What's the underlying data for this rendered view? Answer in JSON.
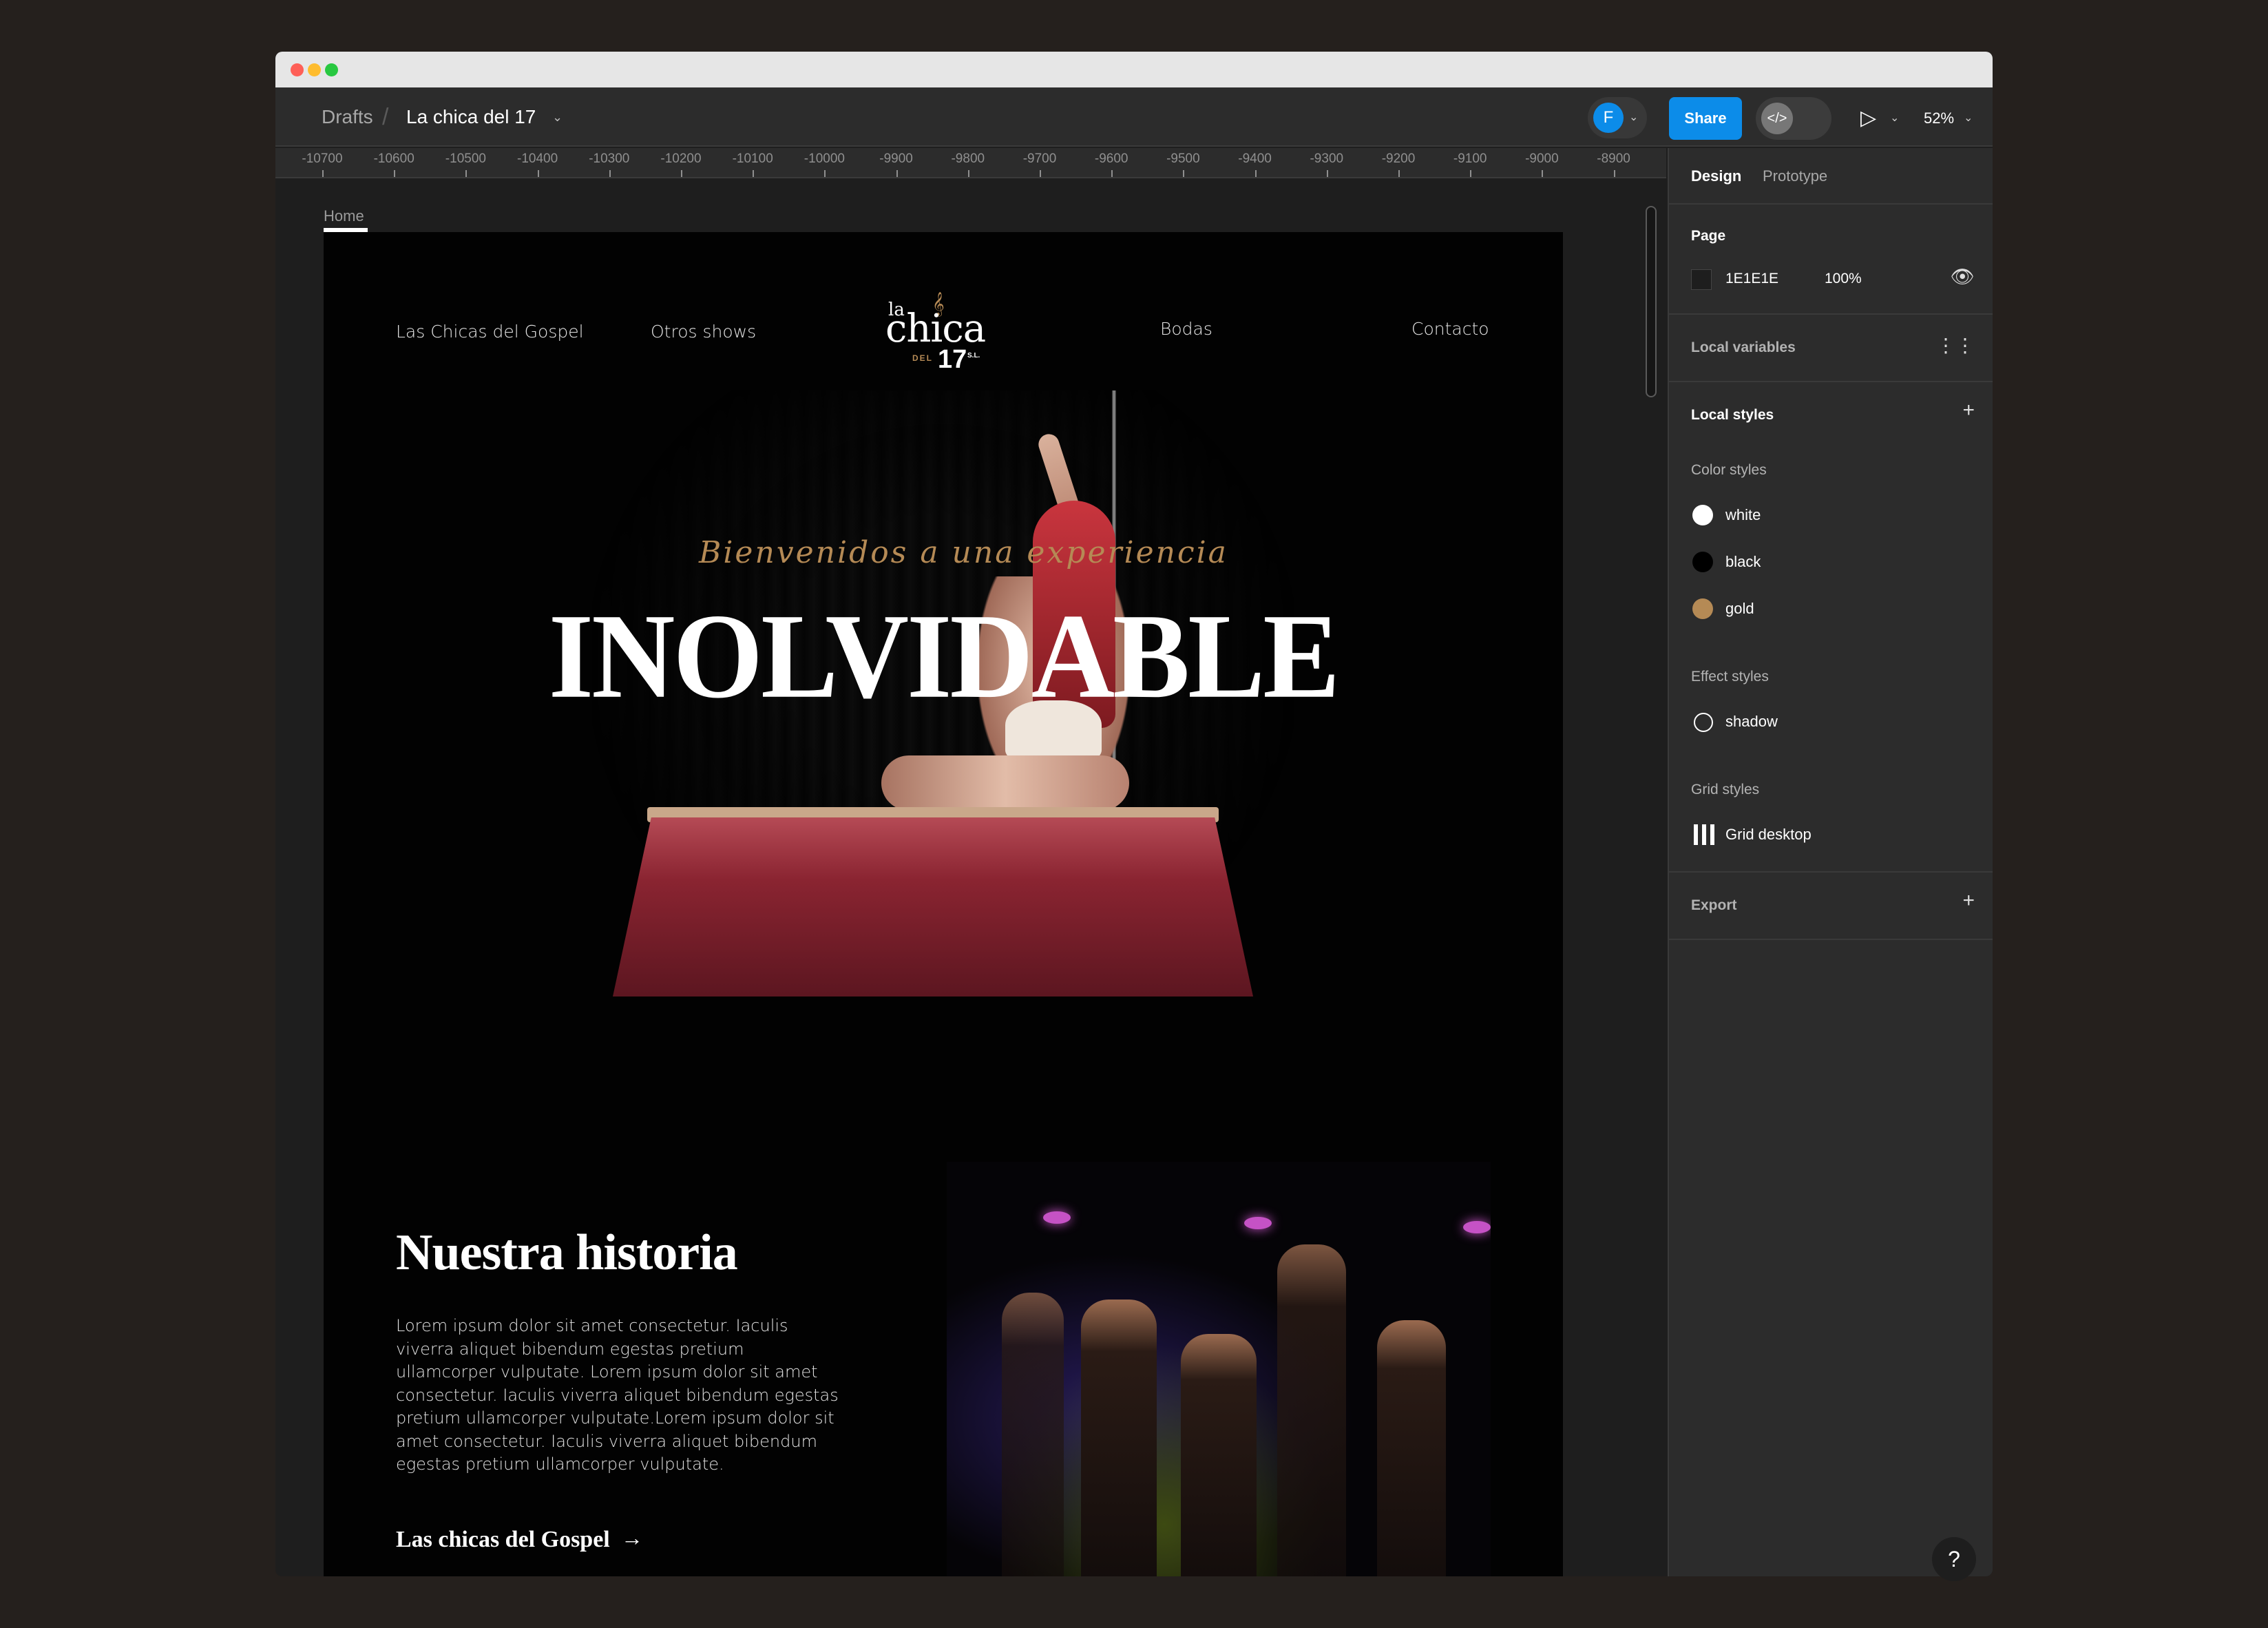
{
  "window": {
    "breadcrumb": {
      "root": "Drafts",
      "separator": "/",
      "file_name": "La chica del 17",
      "file_menu_icon": "chevron-down-icon"
    },
    "toolbar": {
      "avatar_initial": "F",
      "avatar_color": "#0c8ce9",
      "share_label": "Share",
      "dev_mode_icon": "code-icon",
      "present_icon": "play-icon",
      "zoom_level": "52%"
    }
  },
  "ruler": {
    "labels": [
      "-10700",
      "-10600",
      "-10500",
      "-10400",
      "-10300",
      "-10200",
      "-10100",
      "-10000",
      "-9900",
      "-9800",
      "-9700",
      "-9600",
      "-9500",
      "-9400",
      "-9300",
      "-9200",
      "-9100",
      "-9000",
      "-8900"
    ]
  },
  "canvas": {
    "frame_label": "Home",
    "site": {
      "nav": {
        "left": [
          "Las Chicas del Gospel",
          "Otros shows"
        ],
        "right": [
          "Bodas",
          "Contacto"
        ]
      },
      "logo": {
        "la": "la",
        "chica": "chica",
        "del": "DEL",
        "number": "17",
        "suffix": "S.L."
      },
      "hero": {
        "script_text": "Bienvenidos a una experiencia",
        "title": "INOLVIDABLE"
      },
      "story": {
        "title": "Nuestra historia",
        "body": "Lorem ipsum dolor sit amet consectetur. Iaculis viverra aliquet bibendum egestas pretium ullamcorper vulputate. Lorem ipsum dolor sit amet consectetur. Iaculis viverra aliquet bibendum egestas pretium ullamcorper vulputate.Lorem ipsum dolor sit amet consectetur. Iaculis viverra aliquet bibendum egestas pretium ullamcorper vulputate.",
        "link_label": "Las chicas del Gospel",
        "link_icon": "arrow-right-icon"
      },
      "colors": {
        "gold": "#b58a55"
      }
    }
  },
  "panel": {
    "tabs": [
      "Design",
      "Prototype"
    ],
    "active_tab": "Design",
    "page": {
      "title": "Page",
      "color_hex": "1E1E1E",
      "opacity": "100%"
    },
    "local_variables": {
      "title": "Local variables"
    },
    "local_styles": {
      "title": "Local styles",
      "color_styles_title": "Color styles",
      "color_styles": [
        {
          "name": "white",
          "color": "#ffffff"
        },
        {
          "name": "black",
          "color": "#000000"
        },
        {
          "name": "gold",
          "color": "#b58a55"
        }
      ],
      "effect_styles_title": "Effect styles",
      "effect_styles": [
        {
          "name": "shadow"
        }
      ],
      "grid_styles_title": "Grid styles",
      "grid_styles": [
        {
          "name": "Grid desktop"
        }
      ]
    },
    "export": {
      "title": "Export"
    }
  },
  "help": {
    "label": "?"
  }
}
